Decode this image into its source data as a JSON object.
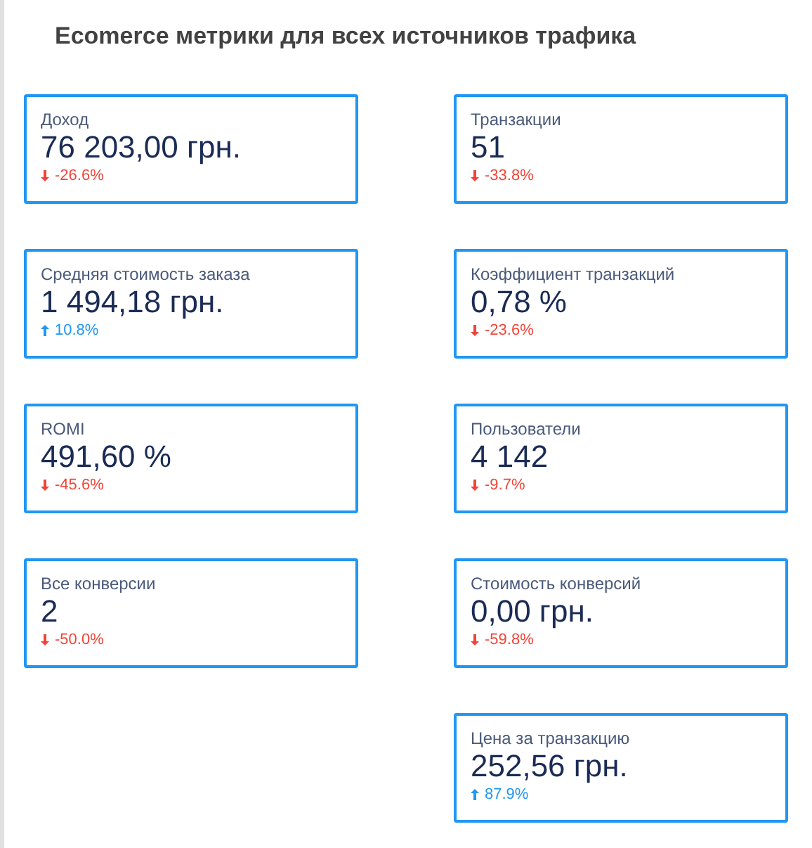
{
  "title": "Ecomerce метрики для всех источников трафика",
  "left_column": [
    {
      "label": "Доход",
      "value": "76 203,00 грн.",
      "change": "-26.6%",
      "kind": "down"
    },
    {
      "label": "Средняя стоимость заказа",
      "value": "1 494,18 грн.",
      "change": "10.8%",
      "kind": "up"
    },
    {
      "label": "ROMI",
      "value": "491,60 %",
      "change": "-45.6%",
      "kind": "down"
    },
    {
      "label": "Все конверсии",
      "value": "2",
      "change": "-50.0%",
      "kind": "down"
    }
  ],
  "right_column": [
    {
      "label": "Транзакции",
      "value": "51",
      "change": "-33.8%",
      "kind": "down"
    },
    {
      "label": "Коэффициент транзакций",
      "value": "0,78 %",
      "change": "-23.6%",
      "kind": "down"
    },
    {
      "label": "Пользователи",
      "value": "4 142",
      "change": "-9.7%",
      "kind": "down"
    },
    {
      "label": "Стоимость конверсий",
      "value": "0,00 грн.",
      "change": "-59.8%",
      "kind": "down"
    },
    {
      "label": "Цена за транзакцию",
      "value": "252,56 грн.",
      "change": "87.9%",
      "kind": "up"
    }
  ]
}
